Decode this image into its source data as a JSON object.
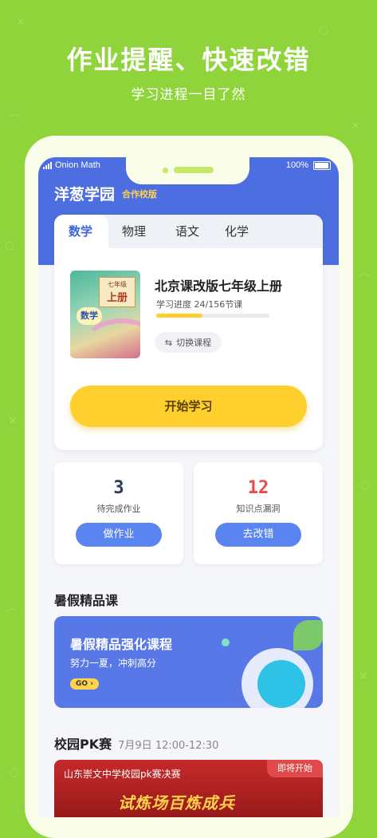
{
  "headline": "作业提醒、快速改错",
  "subline": "学习进程一目了然",
  "status_bar": {
    "carrier": "Onion Math",
    "battery": "100%"
  },
  "app": {
    "brand": "洋葱学园",
    "brand_tag": "合作校版"
  },
  "tabs": [
    {
      "label": "数学"
    },
    {
      "label": "物理"
    },
    {
      "label": "语文"
    },
    {
      "label": "化学"
    }
  ],
  "course": {
    "book_grade": "七年级",
    "book_volume": "上册",
    "book_subject": "数学",
    "title": "北京课改版七年级上册",
    "progress_text": "学习进度  24/156节课",
    "progress_fraction": 0.41,
    "switch_label": "切换课程",
    "start_label": "开始学习"
  },
  "stats": [
    {
      "value": "3",
      "label": "待完成作业",
      "button": "做作业",
      "color": "#2b3a55"
    },
    {
      "value": "12",
      "label": "知识点漏洞",
      "button": "去改错",
      "color": "#e94a4a"
    }
  ],
  "summer": {
    "section_title": "暑假精品课",
    "card_title": "暑假精品强化课程",
    "card_sub": "努力一夏，冲刺高分",
    "go_label": "GO"
  },
  "pk": {
    "section_title": "校园PK赛",
    "section_time": "7月9日 12:00-12:30",
    "banner_title": "山东崇文中学校园pk赛决赛",
    "badge": "即将开始",
    "slogan": "试炼场百炼成兵"
  },
  "colors": {
    "background": "#8fd43a",
    "header_blue": "#4d6ee0",
    "accent_yellow": "#ffcf2e",
    "button_blue": "#5a84ef"
  }
}
